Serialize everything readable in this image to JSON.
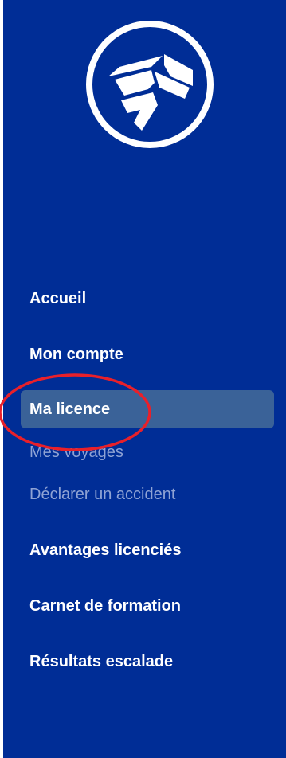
{
  "logo": {
    "icon": "brand-logo-icon",
    "color": "#ffffff"
  },
  "colors": {
    "sidebar_bg": "#002d96",
    "active_bg": "#3a6298",
    "muted_text": "#8fa3d4",
    "annotation": "#e8202a"
  },
  "nav": {
    "items": [
      {
        "label": "Accueil",
        "state": "normal"
      },
      {
        "label": "Mon compte",
        "state": "normal"
      },
      {
        "label": "Ma licence",
        "state": "active"
      },
      {
        "label": "Mes voyages",
        "state": "disabled"
      },
      {
        "label": "Déclarer un accident",
        "state": "disabled"
      },
      {
        "label": "Avantages licenciés",
        "state": "normal"
      },
      {
        "label": "Carnet de formation",
        "state": "normal"
      },
      {
        "label": "Résultats escalade",
        "state": "normal"
      }
    ]
  }
}
